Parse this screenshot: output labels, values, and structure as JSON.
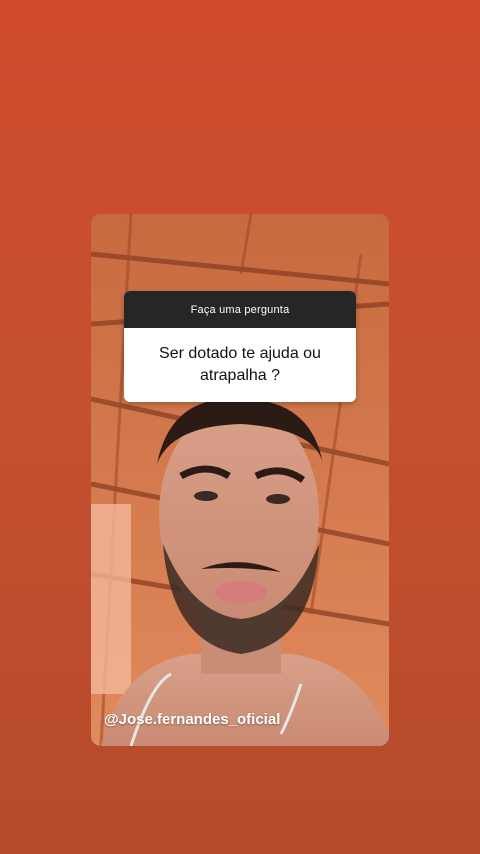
{
  "question_sticker": {
    "header": "Faça uma pergunta",
    "question": "Ser dotado te ajuda ou atrapalha ?"
  },
  "story": {
    "handle": "@Jose.fernandes_oficial"
  },
  "colors": {
    "background": "#cf4a2b",
    "sticker_header": "#262626"
  }
}
